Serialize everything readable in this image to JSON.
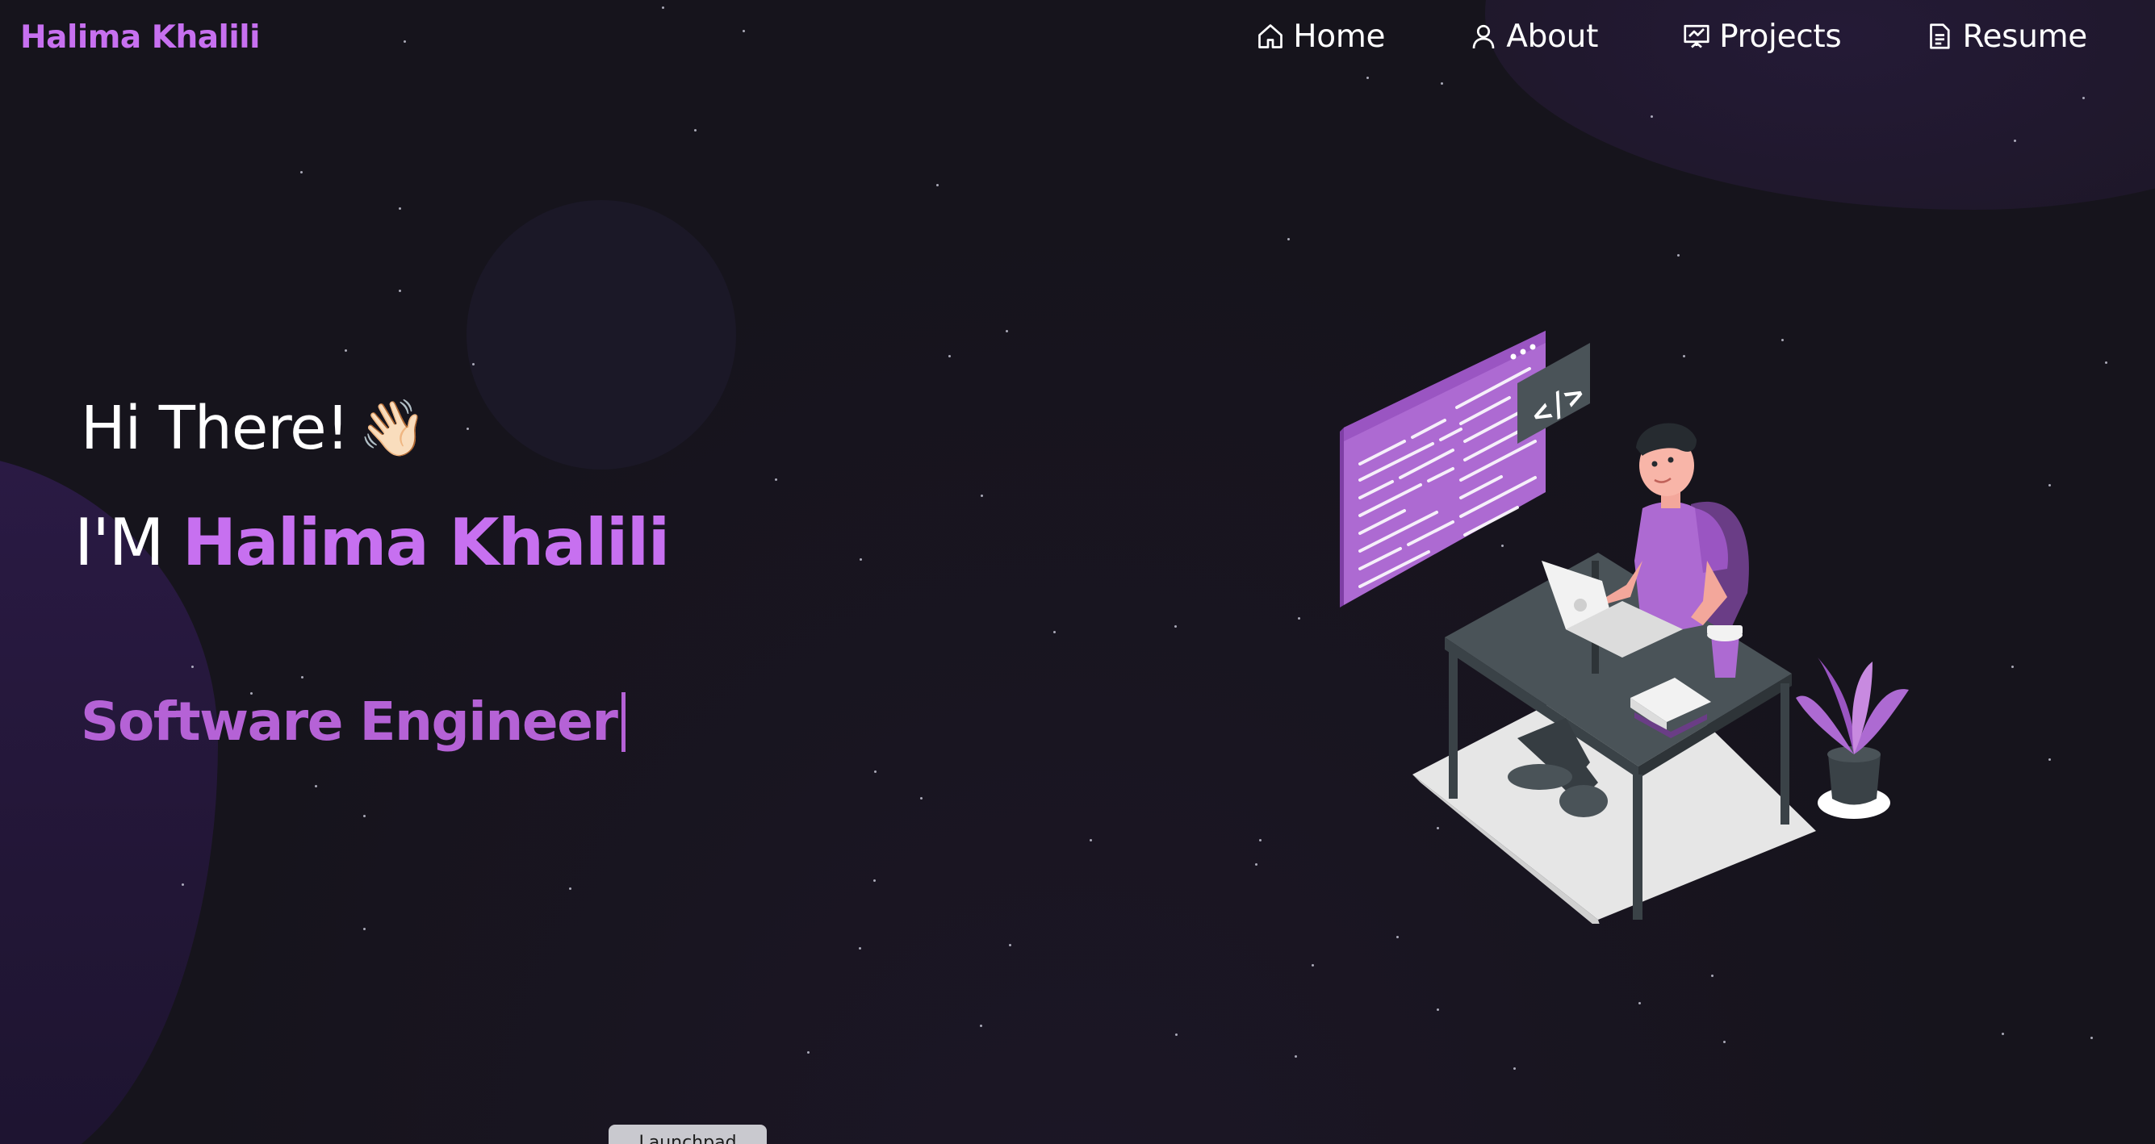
{
  "brand": {
    "name": "Halima Khalili"
  },
  "nav": {
    "items": [
      {
        "label": "Home",
        "icon": "home-icon"
      },
      {
        "label": "About",
        "icon": "user-icon"
      },
      {
        "label": "Projects",
        "icon": "presentation-icon"
      },
      {
        "label": "Resume",
        "icon": "document-icon"
      }
    ]
  },
  "hero": {
    "greeting": "Hi There!",
    "wave_emoji": "👋🏻",
    "im_prefix": "I'M",
    "name": "Halima Khalili",
    "role": "Software Engineer"
  },
  "dock": {
    "launch_label": "Launchpad"
  },
  "colors": {
    "accent": "#c770f0",
    "role": "#b562d6",
    "background": "#16141c"
  }
}
